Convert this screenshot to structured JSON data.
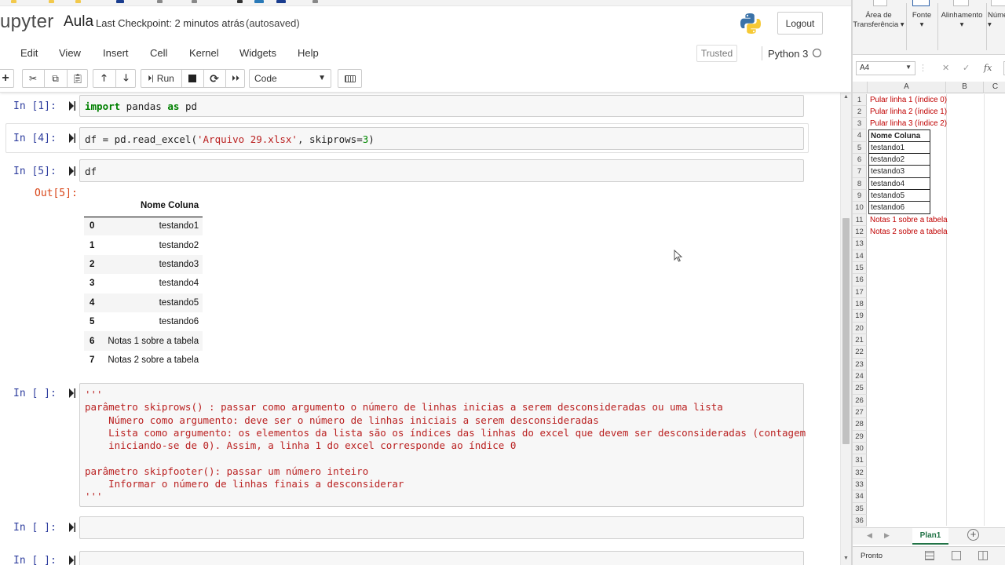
{
  "jupyter": {
    "logo": "upyter",
    "notebook_name": "Aula",
    "checkpoint": "Last Checkpoint: 2 minutos atrás",
    "autosaved": "(autosaved)",
    "logout_label": "Logout",
    "menu": [
      "Edit",
      "View",
      "Insert",
      "Cell",
      "Kernel",
      "Widgets",
      "Help"
    ],
    "trusted_label": "Trusted",
    "kernel_name": "Python 3",
    "toolbar": {
      "add_icon": "plus-icon",
      "cut_icon": "scissors-icon",
      "copy_icon": "copy-icon",
      "paste_icon": "paste-icon",
      "up_icon": "arrow-up-icon",
      "down_icon": "arrow-down-icon",
      "run_label": "Run",
      "stop_icon": "stop-icon",
      "restart_icon": "restart-icon",
      "fastforward_icon": "fast-forward-icon",
      "cell_type": "Code",
      "keyboard_icon": "keyboard-icon"
    },
    "cells": [
      {
        "prompt": "In [1]:",
        "code": "import pandas as pd"
      },
      {
        "prompt": "In [4]:",
        "code": "df = pd.read_excel('Arquivo 29.xlsx', skiprows=3)"
      },
      {
        "prompt": "In [5]:",
        "code": "df",
        "out_prompt": "Out[5]:"
      },
      {
        "prompt": "In [ ]:",
        "docstring": [
          "'''",
          "parâmetro skiprows() : passar como argumento o número de linhas inicias a serem desconsideradas ou uma lista",
          "    Número como argumento: deve ser o número de linhas iniciais a serem desconsideradas",
          "    Lista como argumento: os elementos da lista são os índices das linhas do excel que devem ser desconsideradas (contagem",
          "    iniciando-se de 0). Assim, a linha 1 do excel corresponde ao índice 0",
          "",
          "parâmetro skipfooter(): passar um número inteiro",
          "    Informar o número de linhas finais a desconsiderar",
          "'''"
        ]
      },
      {
        "prompt": "In [ ]:",
        "code": ""
      },
      {
        "prompt": "In [ ]:",
        "code": ""
      }
    ],
    "dataframe": {
      "column": "Nome Coluna",
      "rows": [
        {
          "index": "0",
          "value": "testando1"
        },
        {
          "index": "1",
          "value": "testando2"
        },
        {
          "index": "2",
          "value": "testando3"
        },
        {
          "index": "3",
          "value": "testando4"
        },
        {
          "index": "4",
          "value": "testando5"
        },
        {
          "index": "5",
          "value": "testando6"
        },
        {
          "index": "6",
          "value": "Notas 1 sobre a tabela"
        },
        {
          "index": "7",
          "value": "Notas 2 sobre a tabela"
        }
      ]
    }
  },
  "excel": {
    "ribbon": [
      {
        "label": "Área de\nTransferência ▾"
      },
      {
        "label": "Fonte\n▾"
      },
      {
        "label": "Alinhamento\n▾"
      },
      {
        "label": "Núme\n▾"
      }
    ],
    "name_box": "A4",
    "columns": [
      "A",
      "B",
      "C"
    ],
    "row_count": 36,
    "cells": [
      {
        "row": 1,
        "value": "Pular linha 1 (índice 0)",
        "style": "red"
      },
      {
        "row": 2,
        "value": "Pular linha 2 (índice 1)",
        "style": "red"
      },
      {
        "row": 3,
        "value": "Pular linha 3 (índice 2)",
        "style": "red"
      },
      {
        "row": 4,
        "value": "Nome Coluna",
        "style": "header"
      },
      {
        "row": 5,
        "value": "testando1",
        "style": "box"
      },
      {
        "row": 6,
        "value": "testando2",
        "style": "box"
      },
      {
        "row": 7,
        "value": "testando3",
        "style": "box"
      },
      {
        "row": 8,
        "value": "testando4",
        "style": "box"
      },
      {
        "row": 9,
        "value": "testando5",
        "style": "box"
      },
      {
        "row": 10,
        "value": "testando6",
        "style": "box"
      },
      {
        "row": 11,
        "value": "Notas 1 sobre a tabela",
        "style": "red"
      },
      {
        "row": 12,
        "value": "Notas 2 sobre a tabela",
        "style": "red"
      }
    ],
    "sheet_tab": "Plan1",
    "status": "Pronto",
    "colors": {
      "accent": "#217346",
      "note_red": "#c00000"
    }
  }
}
